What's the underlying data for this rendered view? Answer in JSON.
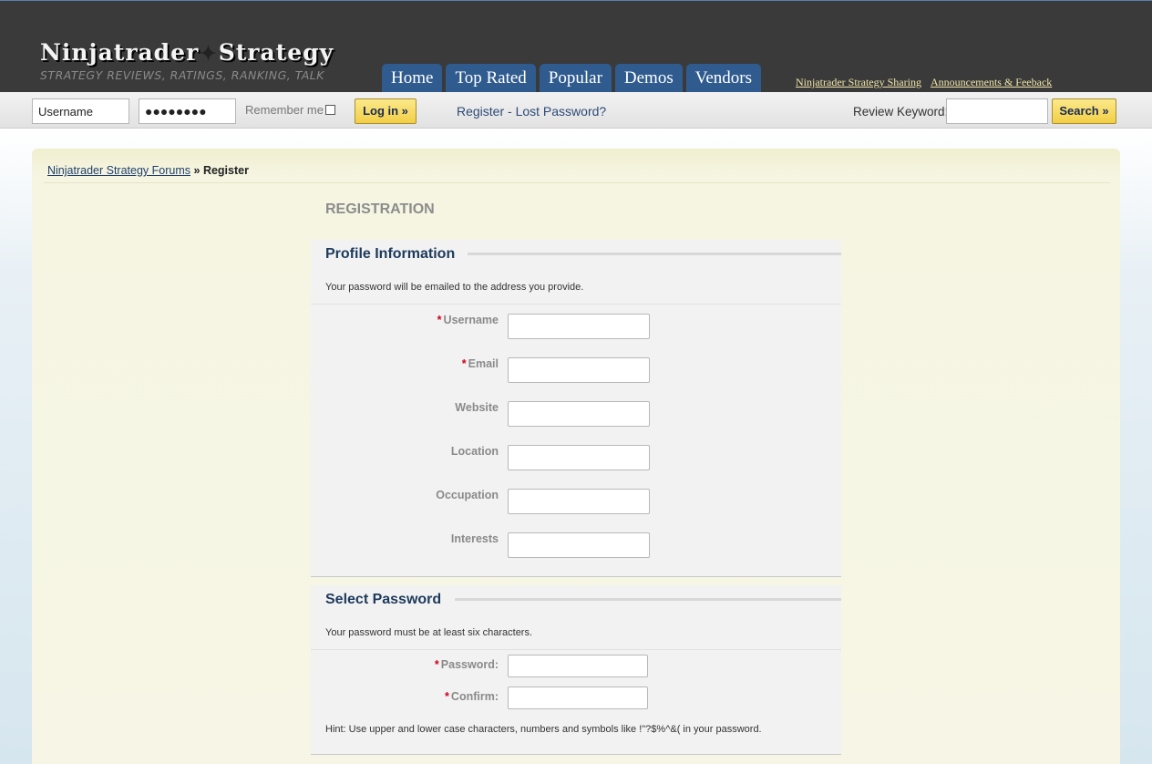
{
  "header": {
    "logo_left": "Ninjatrader",
    "logo_star": "✦",
    "logo_right": "Strategy",
    "tagline": "STRATEGY REVIEWS, RATINGS, RANKING, TALK",
    "nav": [
      "Home",
      "Top Rated",
      "Popular",
      "Demos",
      "Vendors"
    ],
    "links": [
      "Ninjatrader Strategy Sharing",
      "Announcements & Feeback"
    ]
  },
  "loginbar": {
    "username_value": "Username",
    "password_value": "●●●●●●●●",
    "remember_label": "Remember me",
    "login_button": "Log in »",
    "register_link": "Register - Lost Password?",
    "keyword_label": "Review Keyword:",
    "keyword_value": "",
    "search_button": "Search »"
  },
  "breadcrumb": {
    "root": "Ninjatrader Strategy Forums",
    "separator": "»",
    "current": "Register"
  },
  "page_title": "REGISTRATION",
  "profile": {
    "heading": "Profile Information",
    "description": "Your password will be emailed to the address you provide.",
    "fields": [
      {
        "label": "Username",
        "required": "*"
      },
      {
        "label": "Email",
        "required": "*"
      },
      {
        "label": "Website",
        "required": ""
      },
      {
        "label": "Location",
        "required": ""
      },
      {
        "label": "Occupation",
        "required": ""
      },
      {
        "label": "Interests",
        "required": ""
      }
    ]
  },
  "password": {
    "heading": "Select Password",
    "description": "Your password must be at least six characters.",
    "fields": [
      {
        "label": "Password:",
        "required": "*"
      },
      {
        "label": "Confirm:",
        "required": "*"
      }
    ],
    "hint": "Hint: Use upper and lower case characters, numbers and symbols like !\"?$%^&( in your password."
  },
  "colors": {
    "header_bg": "#3a3a3a",
    "nav_tab": "#2f5b8f",
    "button_yellow": "#f2cf45",
    "panel_bg": "#f7f6e6",
    "required_star": "#d0021b",
    "heading_text": "#1d3a5c"
  }
}
